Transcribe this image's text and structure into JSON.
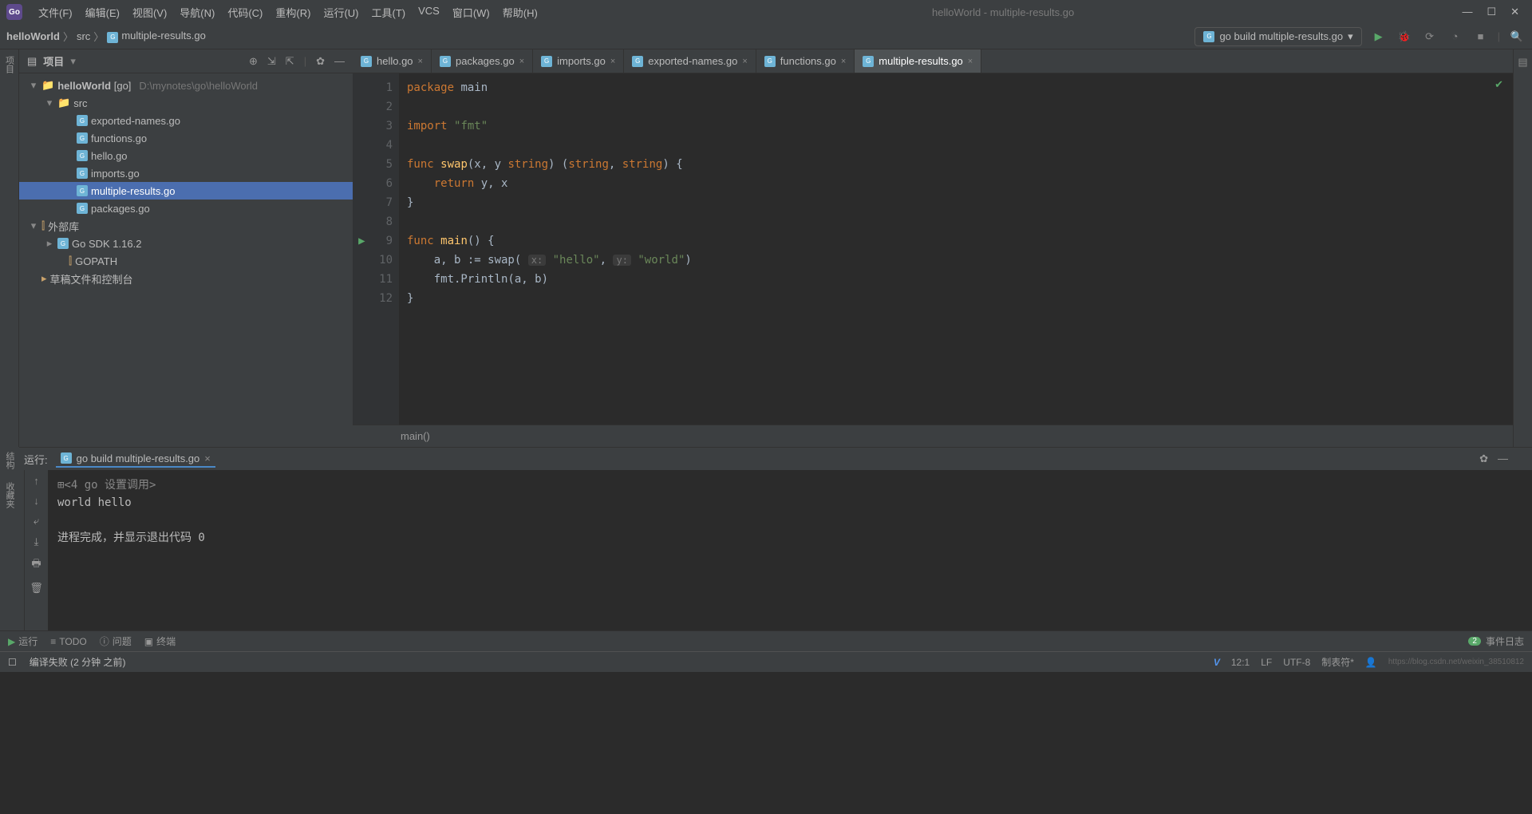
{
  "title": "helloWorld - multiple-results.go",
  "menu": [
    "文件(F)",
    "编辑(E)",
    "视图(V)",
    "导航(N)",
    "代码(C)",
    "重构(R)",
    "运行(U)",
    "工具(T)",
    "VCS",
    "窗口(W)",
    "帮助(H)"
  ],
  "breadcrumb": [
    "helloWorld",
    "src",
    "multiple-results.go"
  ],
  "run_config": "go build multiple-results.go",
  "project": {
    "title": "项目",
    "root": {
      "name": "helloWorld",
      "tag": "[go]",
      "path": "D:\\mynotes\\go\\helloWorld"
    },
    "src": "src",
    "files": [
      "exported-names.go",
      "functions.go",
      "hello.go",
      "imports.go",
      "multiple-results.go",
      "packages.go"
    ],
    "selected": "multiple-results.go",
    "external": "外部库",
    "sdk": "Go SDK 1.16.2",
    "gopath": "GOPATH <go>",
    "scratch": "草稿文件和控制台"
  },
  "tabs": [
    "hello.go",
    "packages.go",
    "imports.go",
    "exported-names.go",
    "functions.go",
    "multiple-results.go"
  ],
  "active_tab": "multiple-results.go",
  "code_lines": [
    {
      "n": 1,
      "html": "<span class='kw'>package</span> main"
    },
    {
      "n": 2,
      "html": ""
    },
    {
      "n": 3,
      "html": "<span class='kw'>import</span> <span class='str'>\"fmt\"</span>"
    },
    {
      "n": 4,
      "html": ""
    },
    {
      "n": 5,
      "html": "<span class='kw'>func</span> <span class='fn'>swap</span>(x, y <span class='kw'>string</span>) (<span class='kw'>string</span>, <span class='kw'>string</span>) {"
    },
    {
      "n": 6,
      "html": "    <span class='kw'>return</span> y, x"
    },
    {
      "n": 7,
      "html": "}"
    },
    {
      "n": 8,
      "html": ""
    },
    {
      "n": 9,
      "html": "<span class='kw'>func</span> <span class='fn'>main</span>() {",
      "run": true
    },
    {
      "n": 10,
      "html": "    a, b := swap( <span class='hint'>x:</span> <span class='str'>\"hello\"</span>, <span class='hint'>y:</span> <span class='str'>\"world\"</span>)"
    },
    {
      "n": 11,
      "html": "    fmt.Println(a, b)"
    },
    {
      "n": 12,
      "html": "}"
    }
  ],
  "editor_status": "main()",
  "run": {
    "label": "运行:",
    "tab": "go build multiple-results.go",
    "output_pre": "<4 go 设置调用>",
    "output": "world hello",
    "exit": "进程完成，并显示退出代码 0"
  },
  "bottom": {
    "run": "运行",
    "todo": "TODO",
    "problems": "问题",
    "terminal": "终端",
    "event_log": "事件日志",
    "event_count": "2"
  },
  "status": {
    "left": "编译失败 (2 分钟 之前)",
    "pos": "12:1",
    "lf": "LF",
    "enc": "UTF-8",
    "spaces": "制表符*",
    "watermark": "https://blog.csdn.net/weixin_38510812"
  },
  "left_tools": [
    "项目"
  ],
  "left_tools2": [
    "结构",
    "收藏夹"
  ]
}
